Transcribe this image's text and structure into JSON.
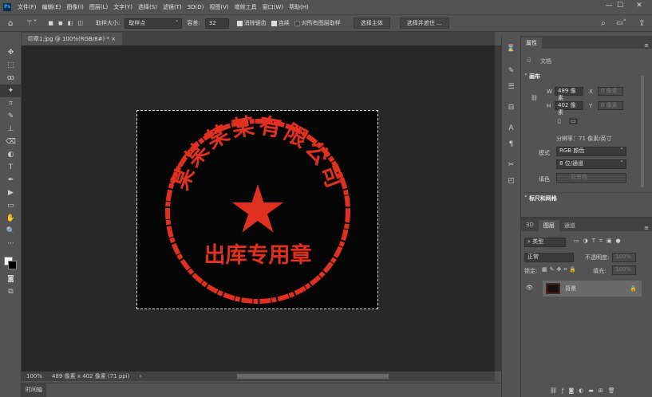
{
  "app": {
    "logo": "Ps"
  },
  "menu": [
    "文件(F)",
    "编辑(E)",
    "图像(I)",
    "图层(L)",
    "文字(Y)",
    "选择(S)",
    "滤镜(T)",
    "3D(D)",
    "视图(V)",
    "增效工具",
    "窗口(W)",
    "帮助(H)"
  ],
  "window_controls": {
    "minimize": "—",
    "maximize": "☐",
    "close": "✕"
  },
  "options": {
    "sample_size_label": "取样大小:",
    "sample_size_value": "取样点",
    "tolerance_label": "容差:",
    "tolerance_value": "32",
    "antialias_label": "消除锯齿",
    "antialias_checked": true,
    "contiguous_label": "连续",
    "contiguous_checked": true,
    "all_layers_label": "对所有图层取样",
    "all_layers_checked": false,
    "select_subject": "选择主体",
    "select_mask": "选择并遮住 ..."
  },
  "document_tab": "印章1.jpg @ 100%(RGB/8#) *  ×",
  "tools": [
    "✥",
    "⬚",
    "ꝏ",
    "✦",
    "⌗",
    "✎",
    "⊥",
    "⌫",
    "◐",
    "T",
    "✒",
    "▶",
    "▭",
    "✋",
    "🔍",
    "···"
  ],
  "stamp": {
    "top_text": "某某某某有限公司",
    "bottom_text": "出库专用章",
    "color": "#e03020"
  },
  "status": {
    "zoom": "100%",
    "info": "489 像素 x 402 像素 (71 ppi)",
    "arrow": "›"
  },
  "timeline_tab": "时间轴",
  "properties": {
    "tab": "属性",
    "doc_label": "文档",
    "canvas_section": "画布",
    "w_label": "W",
    "w_value": "489 像素",
    "h_label": "H",
    "h_value": "402 像素",
    "x_label": "X",
    "x_value": "0 像素",
    "y_label": "Y",
    "y_value": "0 像素",
    "resolution": "分辨率：71 像素/英寸",
    "mode_label": "模式",
    "mode_value": "RGB 颜色",
    "depth_value": "8 位/通道",
    "fill_label": "填色",
    "fill_value": "背景色",
    "rulers_section": "标尺和网格"
  },
  "layers": {
    "tabs": [
      "3D",
      "图层",
      "通道"
    ],
    "active_tab": 1,
    "search_placeholder": "类型",
    "blend_mode": "正常",
    "opacity_label": "不透明度:",
    "opacity_value": "100%",
    "lock_label": "锁定:",
    "fill_label": "填充:",
    "fill_value": "100%",
    "layer_name": "背景",
    "footer_icons": [
      "link",
      "fx",
      "mask",
      "adjustment",
      "folder",
      "new",
      "trash"
    ]
  }
}
